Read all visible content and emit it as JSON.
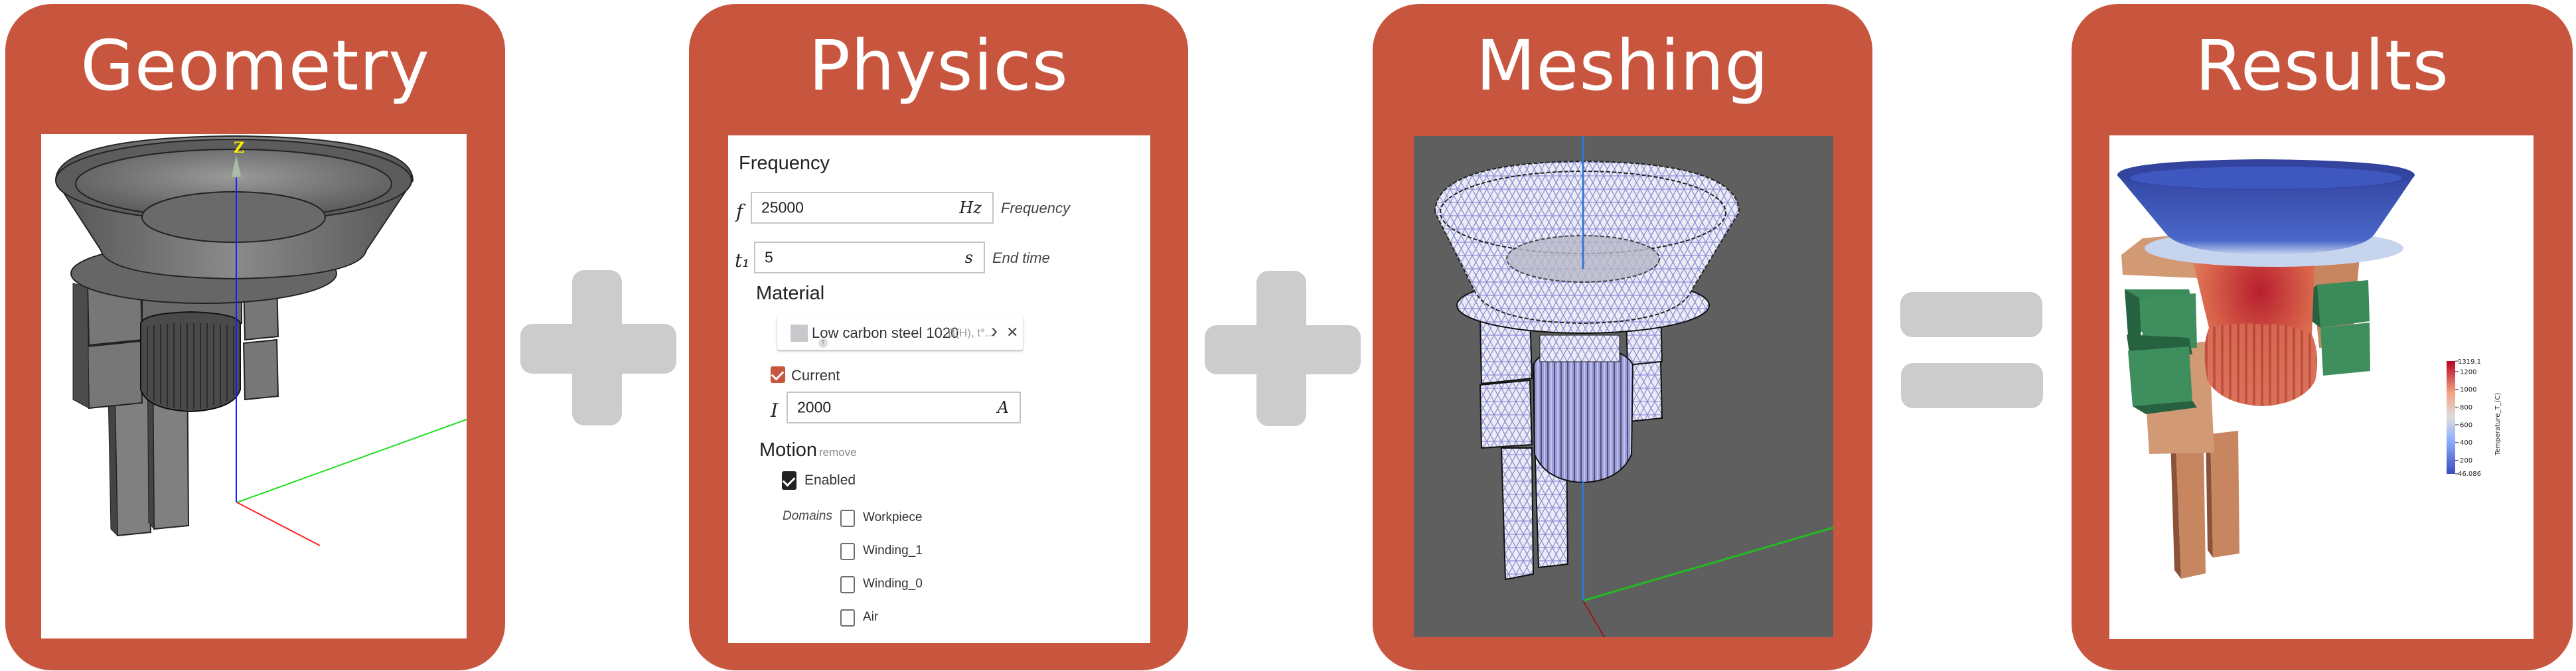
{
  "colors": {
    "panel": "#c8553d",
    "operator": "#cccccc",
    "meshing_background": "#5f5f5f",
    "mesh_lines": "#8f8fd8",
    "axis_x": "#ff2020",
    "axis_y": "#22dd22",
    "axis_z": "#1a1aff",
    "results_coil": "#3a8a5a",
    "results_busbar": "#c88660"
  },
  "operators": [
    "plus",
    "plus",
    "equals"
  ],
  "panels": {
    "geometry": {
      "title": "Geometry",
      "axis_label": "Z"
    },
    "physics": {
      "title": "Physics",
      "frequency_section": "Frequency",
      "fields": [
        {
          "symbol": "f",
          "value": "25000",
          "unit": "Hz",
          "description": "Frequency"
        },
        {
          "symbol": "t₁",
          "value": "5",
          "unit": "s",
          "description": "End time"
        }
      ],
      "material": {
        "heading": "Material",
        "name": "Low carbon steel 1020",
        "properties": "B(H), t°…",
        "badge": "T",
        "chevron_glyph": "›",
        "close_glyph": "✕"
      },
      "current": {
        "label": "Current",
        "checked": true,
        "symbol": "I",
        "value": "2000",
        "unit": "A"
      },
      "motion": {
        "heading": "Motion",
        "remove_label": "remove",
        "enabled_label": "Enabled",
        "enabled_checked": true,
        "domains_label": "Domains",
        "domains": [
          {
            "label": "Workpiece",
            "checked": false
          },
          {
            "label": "Winding_1",
            "checked": false
          },
          {
            "label": "Winding_0",
            "checked": false
          },
          {
            "label": "Air",
            "checked": false
          }
        ]
      }
    },
    "meshing": {
      "title": "Meshing"
    },
    "results": {
      "title": "Results",
      "colorbar": {
        "title": "Temperature_T_(C)",
        "max_label": "1319.1",
        "min_label": "46.086",
        "ticks": [
          "1200",
          "1000",
          "800",
          "600",
          "400",
          "200"
        ],
        "range": [
          46.086,
          1319.1
        ],
        "tick_values": [
          1200,
          1000,
          800,
          600,
          400,
          200
        ]
      }
    }
  }
}
